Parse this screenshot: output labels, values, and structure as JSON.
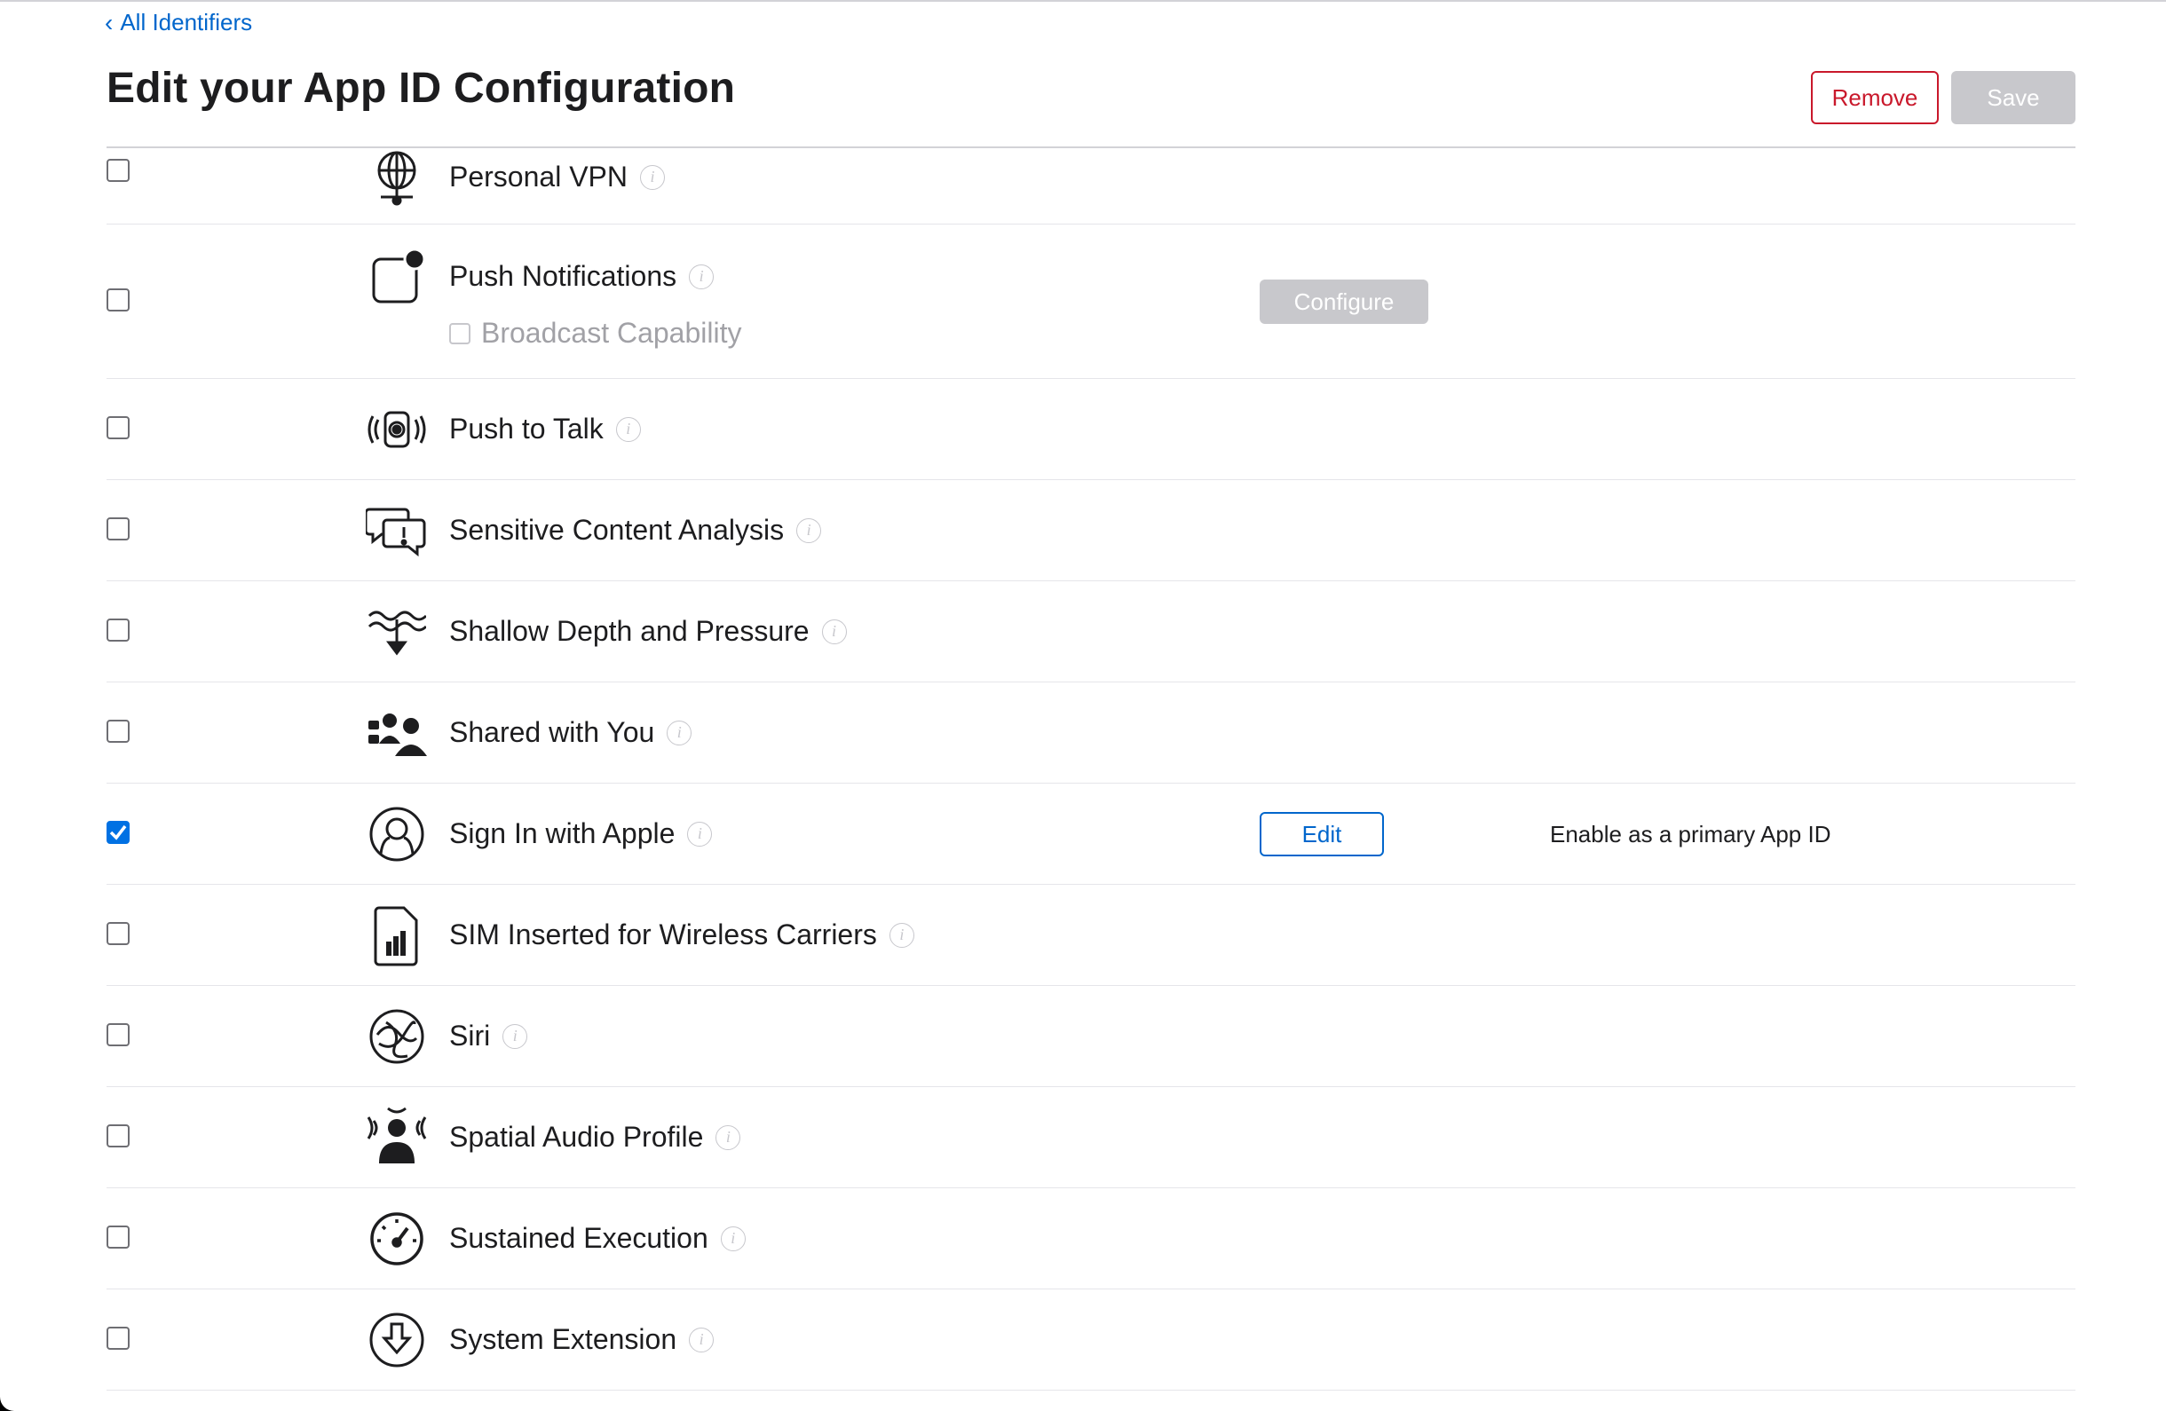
{
  "nav": {
    "back_label": "All Identifiers"
  },
  "header": {
    "title": "Edit your App ID Configuration",
    "remove_label": "Remove",
    "save_label": "Save"
  },
  "colors": {
    "link": "#0066cc",
    "danger": "#c9182b",
    "disabled_button": "#c8c8cc",
    "checkbox_checked": "#0071e3"
  },
  "capabilities": [
    {
      "name": "Personal VPN",
      "icon": "globe-network-icon",
      "checked": false
    },
    {
      "name": "Push Notifications",
      "icon": "notification-badge-icon",
      "checked": false,
      "sub_option": {
        "label": "Broadcast Capability",
        "checked": false,
        "enabled": false
      },
      "action_label": "Configure"
    },
    {
      "name": "Push to Talk",
      "icon": "walkie-talkie-icon",
      "checked": false
    },
    {
      "name": "Sensitive Content Analysis",
      "icon": "speech-bubble-warning-icon",
      "checked": false
    },
    {
      "name": "Shallow Depth and Pressure",
      "icon": "water-depth-icon",
      "checked": false
    },
    {
      "name": "Shared with You",
      "icon": "shared-people-icon",
      "checked": false
    },
    {
      "name": "Sign In with Apple",
      "icon": "person-circle-icon",
      "checked": true,
      "action_label": "Edit",
      "note": "Enable as a primary App ID"
    },
    {
      "name": "SIM Inserted for Wireless Carriers",
      "icon": "sim-card-icon",
      "checked": false
    },
    {
      "name": "Siri",
      "icon": "siri-icon",
      "checked": false
    },
    {
      "name": "Spatial Audio Profile",
      "icon": "spatial-audio-icon",
      "checked": false
    },
    {
      "name": "Sustained Execution",
      "icon": "gauge-icon",
      "checked": false
    },
    {
      "name": "System Extension",
      "icon": "download-circle-icon",
      "checked": false
    }
  ]
}
